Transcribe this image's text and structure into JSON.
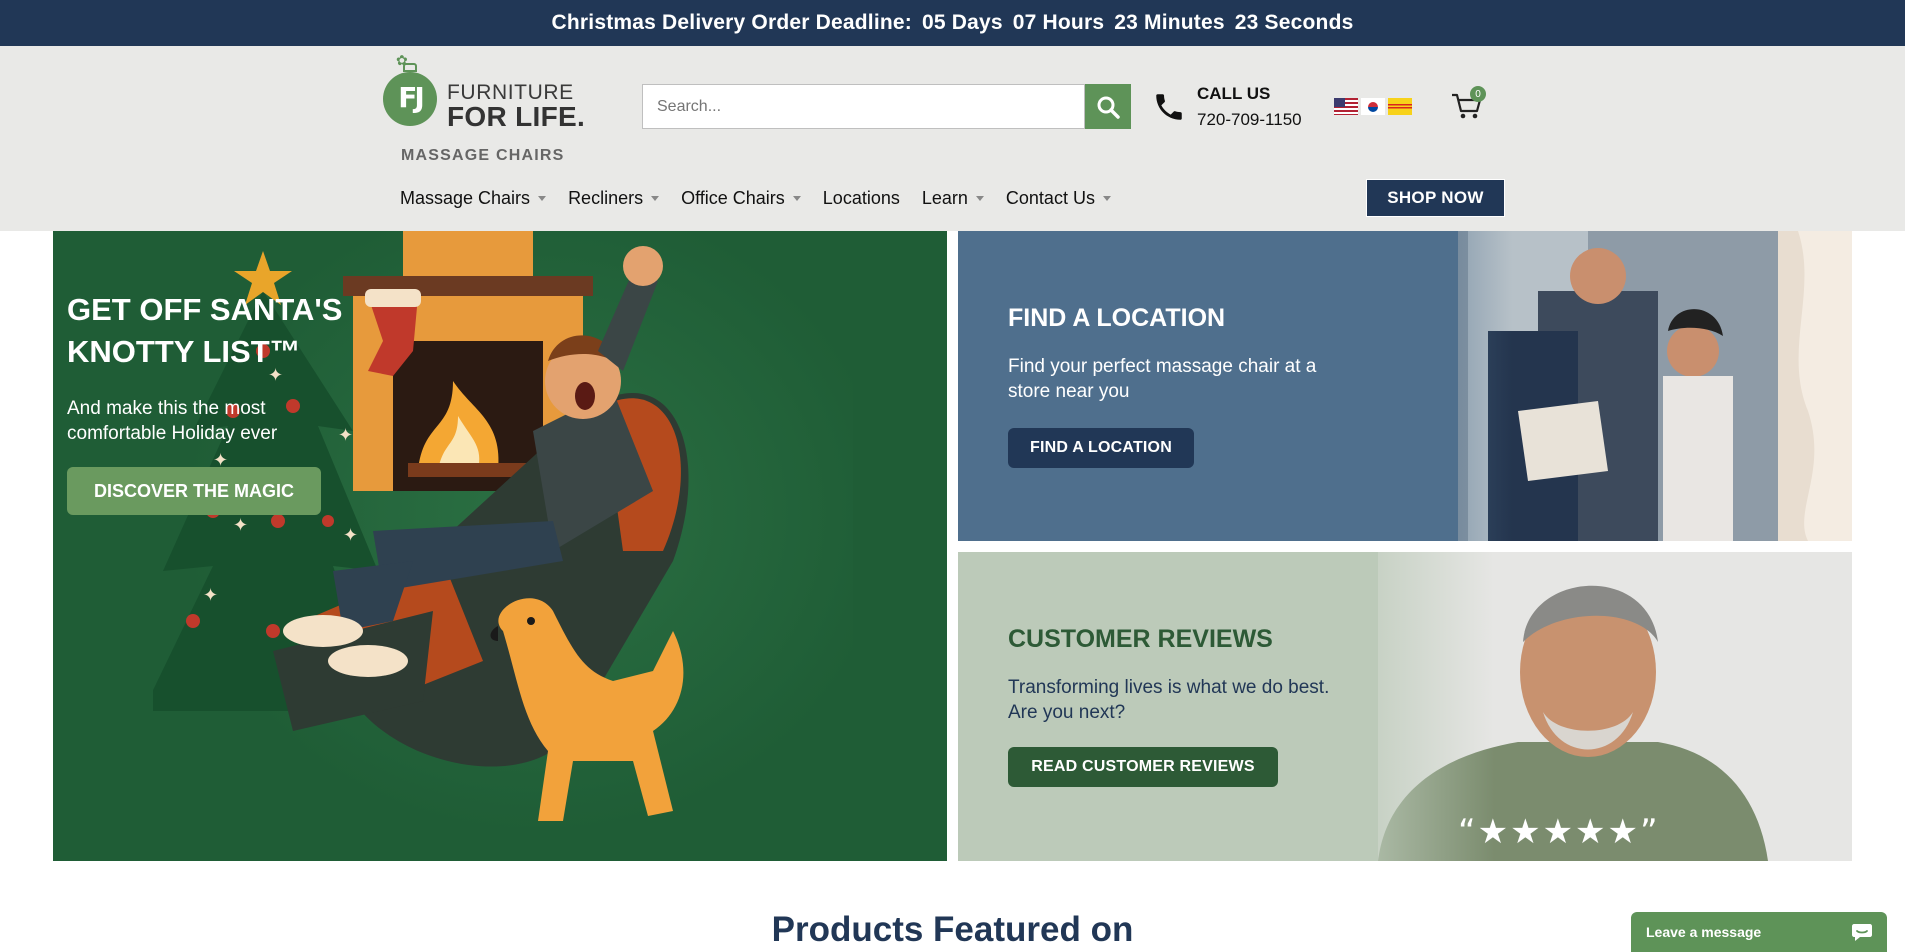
{
  "topbar": {
    "label": "Christmas Delivery Order Deadline:",
    "days": "05 Days",
    "hours": "07 Hours",
    "minutes": "23 Minutes",
    "seconds": "23 Seconds"
  },
  "logo": {
    "mark": "FJ",
    "line1": "FURNITURE",
    "line2": "FOR LIFE.",
    "line3": "MASSAGE CHAIRS"
  },
  "search": {
    "placeholder": "Search..."
  },
  "contact": {
    "title": "CALL US",
    "phone": "720-709-1150"
  },
  "cart": {
    "count": "0"
  },
  "nav": {
    "items": [
      {
        "label": "Massage Chairs",
        "has_dropdown": true
      },
      {
        "label": "Recliners",
        "has_dropdown": true
      },
      {
        "label": "Office Chairs",
        "has_dropdown": true
      },
      {
        "label": "Locations",
        "has_dropdown": false
      },
      {
        "label": "Learn",
        "has_dropdown": true
      },
      {
        "label": "Contact Us",
        "has_dropdown": true
      }
    ],
    "shop_now": "SHOP NOW"
  },
  "hero": {
    "title": "GET OFF SANTA'S KNOTTY LIST™",
    "subtitle": "And make this the most comfortable Holiday ever",
    "button": "DISCOVER THE MAGIC"
  },
  "location_panel": {
    "title": "FIND A LOCATION",
    "subtitle": "Find your perfect massage chair at a store near you",
    "button": "FIND A LOCATION"
  },
  "reviews_panel": {
    "title": "CUSTOMER REVIEWS",
    "subtitle": "Transforming lives is what we do best. Are you next?",
    "button": "READ CUSTOMER REVIEWS",
    "stars": "“★★★★★”"
  },
  "featured": {
    "heading": "Products Featured on"
  },
  "chat": {
    "label": "Leave a message"
  },
  "colors": {
    "navy": "#213756",
    "brand_green": "#5e9358",
    "hero_green": "#1f5d36",
    "review_green": "#2d5a36"
  }
}
